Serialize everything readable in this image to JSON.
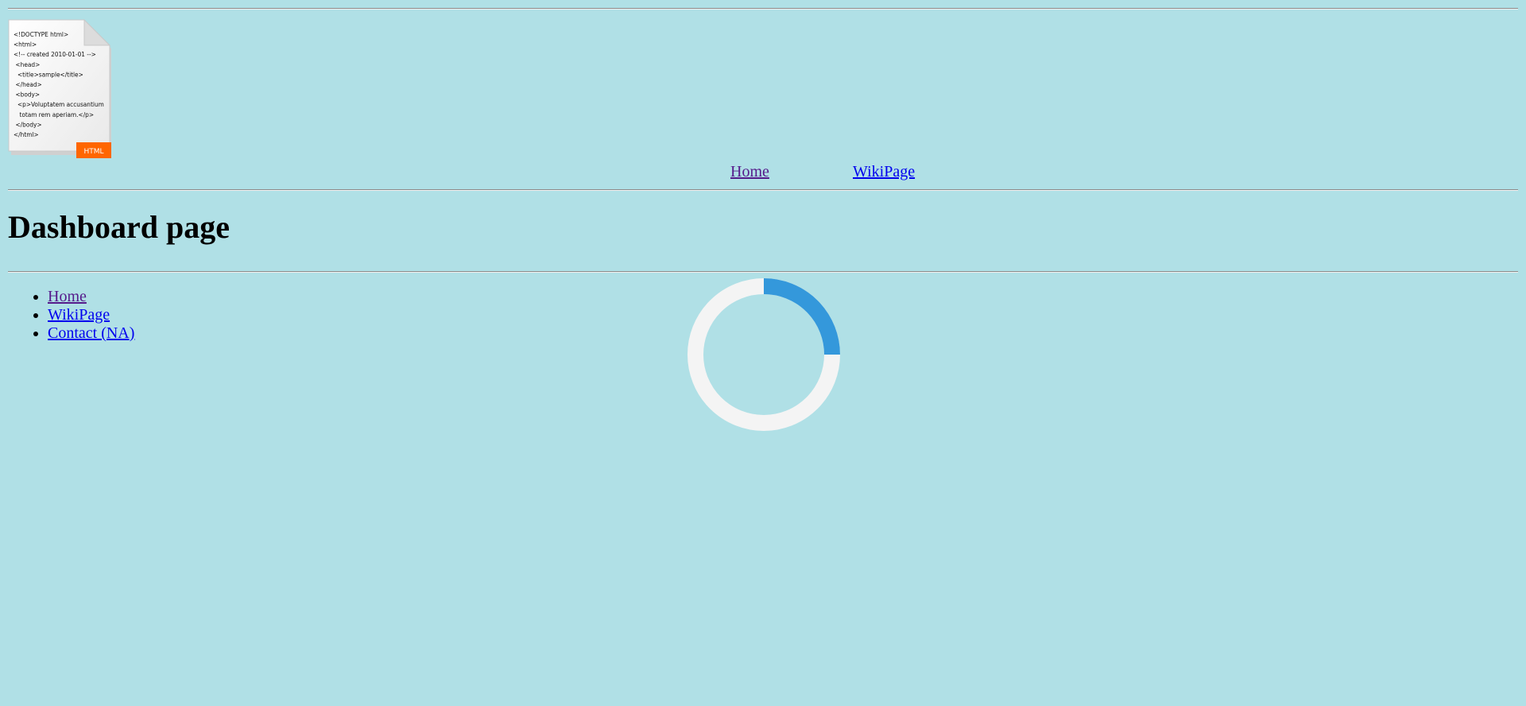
{
  "logo": {
    "code_lines": [
      "<!DOCTYPE html>",
      "<html>",
      "<!-- created 2010-01-01 -->",
      "<head>",
      "<title>sample</title>",
      "</head>",
      "<body>",
      "<p>Voluptatem accusantium",
      "totam rem aperiam.</p>",
      "</body>",
      "</html>"
    ],
    "badge": "HTML"
  },
  "topnav": {
    "home": "Home",
    "wiki": "WikiPage"
  },
  "page": {
    "title": "Dashboard page"
  },
  "sidenav": {
    "items": [
      {
        "label": "Home"
      },
      {
        "label": "WikiPage"
      },
      {
        "label": "Contact (NA)"
      }
    ]
  },
  "spinner": {
    "track_color": "#f4f4f4",
    "arc_color": "#3498db",
    "progress": 0.25
  },
  "colors": {
    "background": "#b0e0e6",
    "link": "#0000ee",
    "visited_link": "#551a8b",
    "badge": "#ff6600"
  }
}
